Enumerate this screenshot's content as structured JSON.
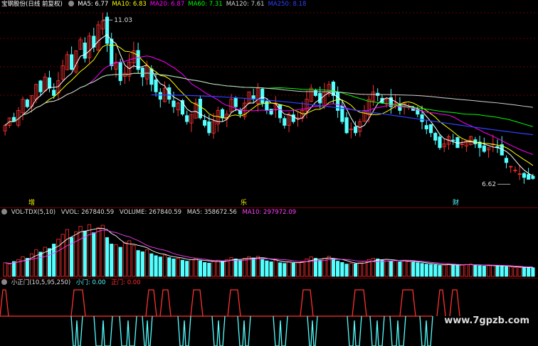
{
  "header": {
    "title": "宝钢股份(日线 前复权)",
    "ma": [
      {
        "label": "MA5: 6.77",
        "color": "#ffffff"
      },
      {
        "label": "MA10: 6.83",
        "color": "#ffff00"
      },
      {
        "label": "MA20: 6.87",
        "color": "#ff00ff"
      },
      {
        "label": "MA60: 7.31",
        "color": "#00ff00"
      },
      {
        "label": "MA120: 7.61",
        "color": "#d0d0d0"
      },
      {
        "label": "MA250: 8.18",
        "color": "#3040ff"
      }
    ]
  },
  "price_annotations": {
    "high": "11.03",
    "low": "6.62",
    "markers": [
      "增",
      "乐",
      "财"
    ]
  },
  "vol_header": {
    "name": "VOL-TDX(5,10)",
    "vvol": "VVOL: 267840.59",
    "volume": "VOLUME: 267840.59",
    "ma5": "MA5: 358672.56",
    "ma10": "MA10: 297972.09"
  },
  "ind_header": {
    "name": "小正门(10,5,95,250)",
    "small": "小门: 0.00",
    "main": "正门: 0.00"
  },
  "watermark": "www.7gpzb.com",
  "colors": {
    "up": "#ff3030",
    "down": "#54ffff",
    "background": "#000000"
  },
  "chart_data": [
    {
      "type": "candlestick",
      "title": "宝钢股份(日线 前复权)",
      "ylim": [
        6.3,
        11.3
      ],
      "close": [
        8.2,
        8.4,
        8.3,
        8.6,
        8.9,
        8.7,
        9.0,
        9.3,
        9.1,
        9.5,
        9.2,
        9.0,
        9.4,
        9.8,
        10.1,
        9.7,
        10.2,
        10.5,
        10.0,
        10.6,
        10.3,
        10.9,
        11.0,
        10.4,
        9.8,
        9.9,
        9.4,
        9.6,
        9.9,
        10.2,
        9.7,
        9.5,
        9.8,
        9.3,
        9.1,
        8.9,
        9.2,
        8.9,
        8.7,
        8.8,
        8.5,
        8.3,
        8.5,
        8.8,
        8.4,
        8.2,
        8.0,
        8.3,
        8.6,
        8.4,
        8.5,
        8.9,
        8.7,
        8.5,
        8.8,
        9.1,
        8.9,
        9.2,
        8.8,
        8.6,
        8.5,
        8.8,
        8.4,
        8.2,
        8.5,
        8.3,
        8.4,
        8.6,
        8.9,
        9.2,
        9.0,
        8.8,
        9.1,
        9.3,
        9.0,
        8.6,
        8.3,
        8.0,
        8.1,
        8.0,
        8.3,
        8.6,
        8.9,
        9.1,
        9.0,
        8.8,
        8.9,
        8.7,
        8.8,
        8.6,
        8.8,
        8.7,
        8.6,
        8.5,
        8.3,
        8.1,
        8.0,
        7.8,
        7.6,
        7.7,
        7.9,
        7.8,
        7.6,
        7.7,
        7.8,
        7.9,
        7.7,
        7.6,
        7.5,
        7.6,
        7.7,
        7.6,
        7.4,
        7.2,
        7.1,
        7.0,
        6.9,
        6.8,
        6.75,
        6.77
      ],
      "high_value": 11.03,
      "low_value": 6.62,
      "series": [
        {
          "name": "MA5",
          "last": 6.77
        },
        {
          "name": "MA10",
          "last": 6.83
        },
        {
          "name": "MA20",
          "last": 6.87
        },
        {
          "name": "MA60",
          "last": 7.31
        },
        {
          "name": "MA120",
          "last": 7.61
        },
        {
          "name": "MA250",
          "last": 8.18
        }
      ]
    },
    {
      "type": "bar",
      "title": "VOL-TDX(5,10)",
      "ylim": [
        0,
        1800000
      ],
      "last_volume": 267840.59,
      "ma5": 358672.56,
      "ma10": 297972.09,
      "values": [
        420000,
        380000,
        460000,
        520000,
        610000,
        560000,
        700000,
        820000,
        750000,
        900000,
        860000,
        1000000,
        1150000,
        1300000,
        1450000,
        1200000,
        1380000,
        1550000,
        1400000,
        1600000,
        1350000,
        1500000,
        1580000,
        1200000,
        1000000,
        980000,
        900000,
        1050000,
        1100000,
        950000,
        800000,
        760000,
        820000,
        700000,
        640000,
        600000,
        660000,
        580000,
        540000,
        560000,
        500000,
        470000,
        520000,
        560000,
        480000,
        430000,
        410000,
        460000,
        500000,
        470000,
        520000,
        580000,
        540000,
        500000,
        560000,
        610000,
        570000,
        620000,
        520000,
        480000,
        450000,
        500000,
        420000,
        400000,
        450000,
        410000,
        430000,
        470000,
        540000,
        600000,
        560000,
        500000,
        560000,
        620000,
        540000,
        470000,
        430000,
        380000,
        400000,
        390000,
        420000,
        470000,
        520000,
        560000,
        540000,
        500000,
        520000,
        470000,
        490000,
        450000,
        480000,
        460000,
        440000,
        420000,
        400000,
        380000,
        370000,
        360000,
        340000,
        350000,
        380000,
        360000,
        340000,
        350000,
        370000,
        380000,
        350000,
        330000,
        320000,
        330000,
        340000,
        330000,
        310000,
        300000,
        290000,
        280000,
        270000,
        265000,
        270000,
        267840
      ]
    },
    {
      "type": "line",
      "title": "小正门(10,5,95,250)",
      "series": [
        {
          "name": "小门",
          "last": 0.0
        },
        {
          "name": "正门",
          "last": 0.0
        }
      ]
    }
  ]
}
